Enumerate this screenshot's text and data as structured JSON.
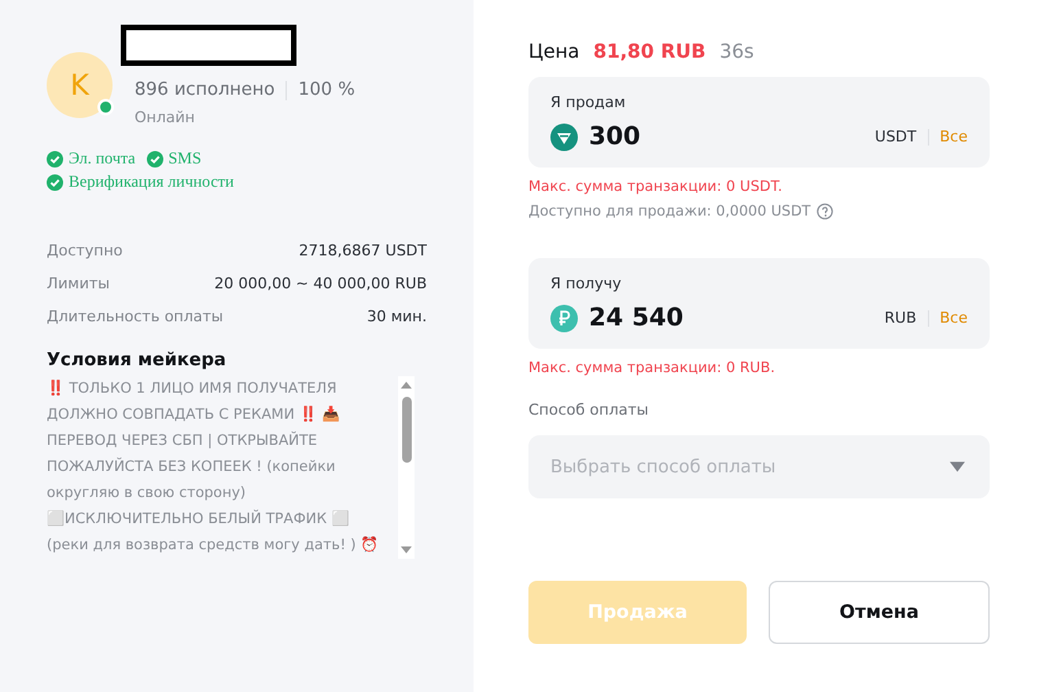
{
  "maker": {
    "avatar_letter": "K",
    "online": true,
    "completed": "896 исполнено",
    "rate": "100 %",
    "status": "Онлайн",
    "verifications": [
      {
        "label": "Эл. почта",
        "checked": true
      },
      {
        "label": "SMS",
        "checked": true
      },
      {
        "label": "Верификация личности",
        "checked": true
      }
    ]
  },
  "details": [
    {
      "label": "Доступно",
      "value": "2718,6867 USDT"
    },
    {
      "label": "Лимиты",
      "value": "20 000,00 ~ 40 000,00 RUB"
    },
    {
      "label": "Длительность оплаты",
      "value": "30 мин."
    }
  ],
  "terms": {
    "title": "Условия мейкера",
    "text": "‼️ ТОЛЬКО 1 ЛИЦО ИМЯ ПОЛУЧАТЕЛЯ ДОЛЖНО СОВПАДАТЬ С РЕКАМИ ‼️ 📥 ПЕРЕВОД ЧЕРЕЗ СБП | ОТКРЫВАЙТЕ ПОЖАЛУЙСТА БЕЗ КОПЕЕК ! (копейки округляю в свою сторону) ⬜ИСКЛЮЧИТЕЛЬНО БЕЛЫЙ ТРАФИК ⬜ (реки для возврата средств могу дать! ) ⏰"
  },
  "price": {
    "label": "Цена",
    "value": "81,80 RUB",
    "timer": "36s"
  },
  "amounts": [
    {
      "kind": "usdt",
      "label": "Я продам",
      "value": "300",
      "currency": "USDT",
      "all": "Все",
      "error": "Макс. сумма транзакции: 0 USDT.",
      "note": "Доступно для продажи: 0,0000 USDT"
    },
    {
      "kind": "rub",
      "label": "Я получу",
      "value": "24 540",
      "currency": "RUB",
      "all": "Все",
      "error": "Макс. сумма транзакции: 0 RUB."
    }
  ],
  "payment": {
    "label": "Способ оплаты",
    "placeholder": "Выбрать способ оплаты"
  },
  "buttons": [
    {
      "label": "Продажа",
      "kind": "primary",
      "disabled": true
    },
    {
      "label": "Отмена",
      "kind": "secondary",
      "disabled": false
    }
  ]
}
